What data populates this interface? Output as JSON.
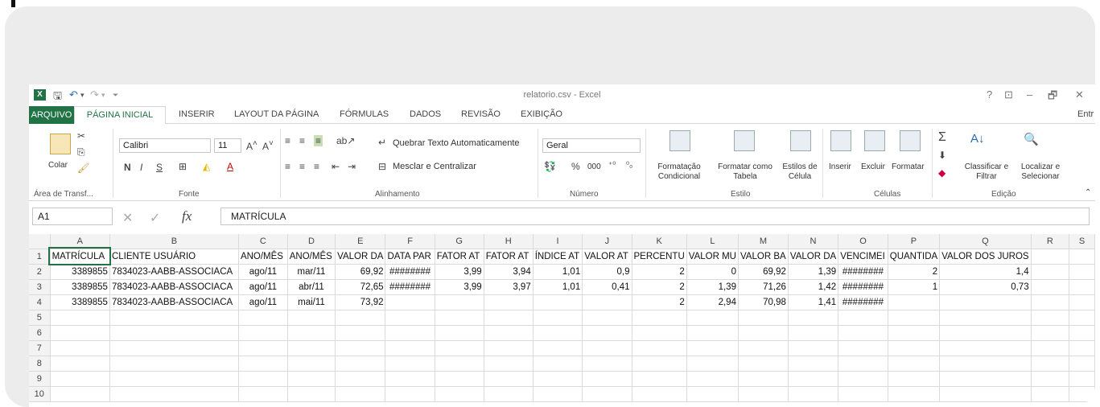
{
  "window": {
    "title": "relatorio.csv - Excel",
    "help": "?",
    "minimize": "–",
    "restore": "🗗",
    "close": "✕"
  },
  "tabs": {
    "file": "ARQUIVO",
    "items": [
      "PÁGINA INICIAL",
      "INSERIR",
      "LAYOUT DA PÁGINA",
      "FÓRMULAS",
      "DADOS",
      "REVISÃO",
      "EXIBIÇÃO"
    ],
    "overflow": "Entr"
  },
  "ribbon": {
    "clipboard": {
      "paste": "Colar",
      "label": "Área de Transf..."
    },
    "font": {
      "name": "Calibri",
      "size": "11",
      "bold": "N",
      "italic": "I",
      "underline": "S",
      "label": "Fonte"
    },
    "alignment": {
      "wrap": "Quebrar Texto Automaticamente",
      "merge": "Mesclar e Centralizar",
      "label": "Alinhamento"
    },
    "number": {
      "format": "Geral",
      "percent": "%",
      "thousands": "000",
      "label": "Número"
    },
    "styles": {
      "conditional": "Formatação Condicional",
      "table": "Formatar como Tabela",
      "cell": "Estilos de Célula",
      "label": "Estilo"
    },
    "cells": {
      "insert": "Inserir",
      "delete": "Excluir",
      "format": "Formatar",
      "label": "Células"
    },
    "editing": {
      "sort": "Classificar e Filtrar",
      "find": "Localizar e Selecionar",
      "label": "Edição"
    }
  },
  "formula_bar": {
    "name_box": "A1",
    "fx": "fx",
    "content": "MATRÍCULA"
  },
  "grid": {
    "columns": [
      "A",
      "B",
      "C",
      "D",
      "E",
      "F",
      "G",
      "H",
      "I",
      "J",
      "K",
      "L",
      "M",
      "N",
      "O",
      "P",
      "Q",
      "R",
      "S"
    ],
    "rows": [
      [
        "MATRÍCULA",
        "CLIENTE USUÁRIO",
        "ANO/MÊS",
        "ANO/MÊS",
        "VALOR DA",
        "DATA PAR",
        "FATOR AT",
        "FATOR AT",
        "ÍNDICE AT",
        "VALOR AT",
        "PERCENTU",
        "VALOR MU",
        "VALOR BA",
        "VALOR DA",
        "VENCIMEI",
        "QUANTIDA",
        "VALOR DOS JUROS",
        "",
        ""
      ],
      [
        "3389855",
        "7834023-AABB-ASSOCIACA",
        "ago/11",
        "mar/11",
        "69,92",
        "########",
        "3,99",
        "3,94",
        "1,01",
        "0,9",
        "2",
        "0",
        "69,92",
        "1,39",
        "########",
        "2",
        "1,4",
        "",
        ""
      ],
      [
        "3389855",
        "7834023-AABB-ASSOCIACA",
        "ago/11",
        "abr/11",
        "72,65",
        "########",
        "3,99",
        "3,97",
        "1,01",
        "0,41",
        "2",
        "1,39",
        "71,26",
        "1,42",
        "########",
        "1",
        "0,73",
        "",
        ""
      ],
      [
        "3389855",
        "7834023-AABB-ASSOCIACA",
        "ago/11",
        "mai/11",
        "73,92",
        "",
        "",
        "",
        "",
        "",
        "2",
        "2,94",
        "70,98",
        "1,41",
        "########",
        "",
        "",
        "",
        ""
      ],
      [
        "",
        "",
        "",
        "",
        "",
        "",
        "",
        "",
        "",
        "",
        "",
        "",
        "",
        "",
        "",
        "",
        "",
        "",
        ""
      ],
      [
        "",
        "",
        "",
        "",
        "",
        "",
        "",
        "",
        "",
        "",
        "",
        "",
        "",
        "",
        "",
        "",
        "",
        "",
        ""
      ],
      [
        "",
        "",
        "",
        "",
        "",
        "",
        "",
        "",
        "",
        "",
        "",
        "",
        "",
        "",
        "",
        "",
        "",
        "",
        ""
      ],
      [
        "",
        "",
        "",
        "",
        "",
        "",
        "",
        "",
        "",
        "",
        "",
        "",
        "",
        "",
        "",
        "",
        "",
        "",
        ""
      ],
      [
        "",
        "",
        "",
        "",
        "",
        "",
        "",
        "",
        "",
        "",
        "",
        "",
        "",
        "",
        "",
        "",
        "",
        "",
        ""
      ],
      [
        "",
        "",
        "",
        "",
        "",
        "",
        "",
        "",
        "",
        "",
        "",
        "",
        "",
        "",
        "",
        "",
        "",
        "",
        ""
      ]
    ]
  }
}
